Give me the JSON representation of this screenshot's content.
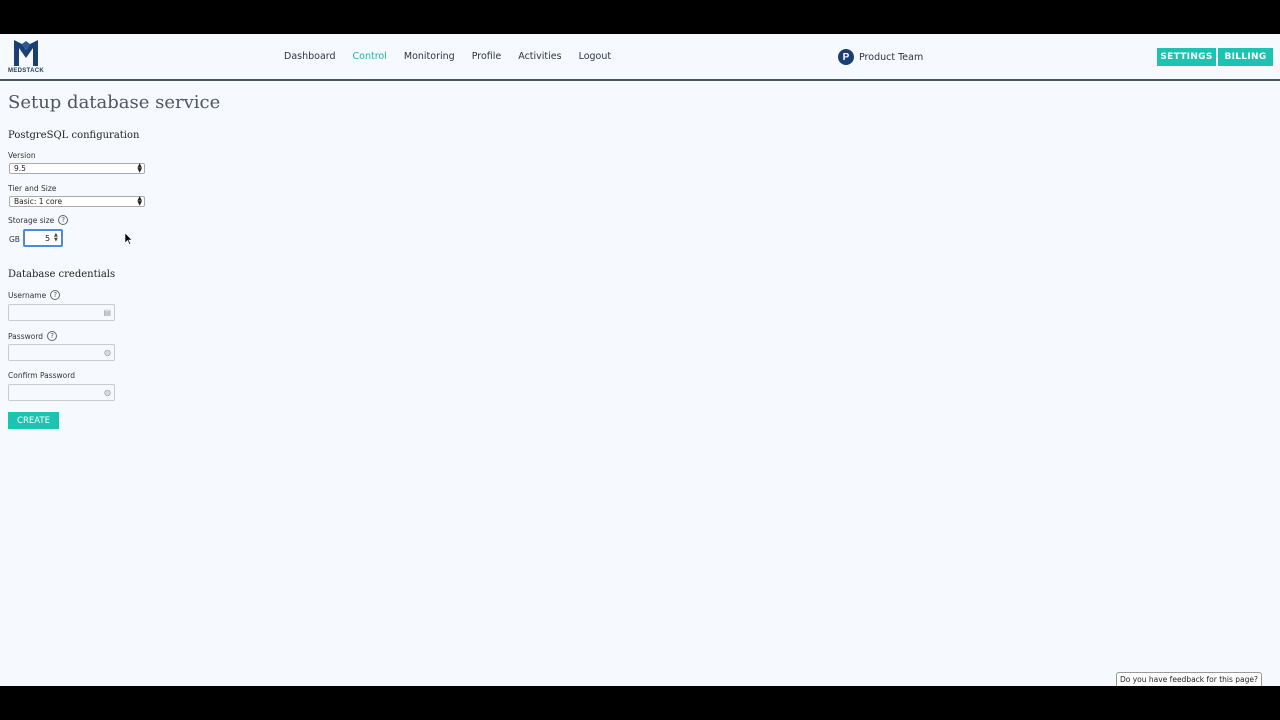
{
  "brand": {
    "name": "MEDSTACK"
  },
  "nav": {
    "items": [
      {
        "label": "Dashboard",
        "active": false
      },
      {
        "label": "Control",
        "active": true
      },
      {
        "label": "Monitoring",
        "active": false
      },
      {
        "label": "Profile",
        "active": false
      },
      {
        "label": "Activities",
        "active": false
      },
      {
        "label": "Logout",
        "active": false
      }
    ]
  },
  "team": {
    "initial": "P",
    "name": "Product Team"
  },
  "header_buttons": {
    "settings": "SETTINGS",
    "billing": "BILLING"
  },
  "page": {
    "title": "Setup database service"
  },
  "postgres": {
    "section_title": "PostgreSQL configuration",
    "version": {
      "label": "Version",
      "value": "9.5"
    },
    "tier": {
      "label": "Tier and Size",
      "value": "Basic: 1 core"
    },
    "storage": {
      "label": "Storage size",
      "unit": "GB",
      "value": "5"
    }
  },
  "credentials": {
    "section_title": "Database credentials",
    "username": {
      "label": "Username",
      "value": ""
    },
    "password": {
      "label": "Password",
      "value": ""
    },
    "confirm_password": {
      "label": "Confirm Password",
      "value": ""
    }
  },
  "actions": {
    "create": "CREATE"
  },
  "feedback": {
    "label": "Do you have feedback for this page?"
  },
  "colors": {
    "accent": "#1cc3b0",
    "brand_navy": "#1b3f73",
    "focus_blue": "#4f8ad9"
  }
}
